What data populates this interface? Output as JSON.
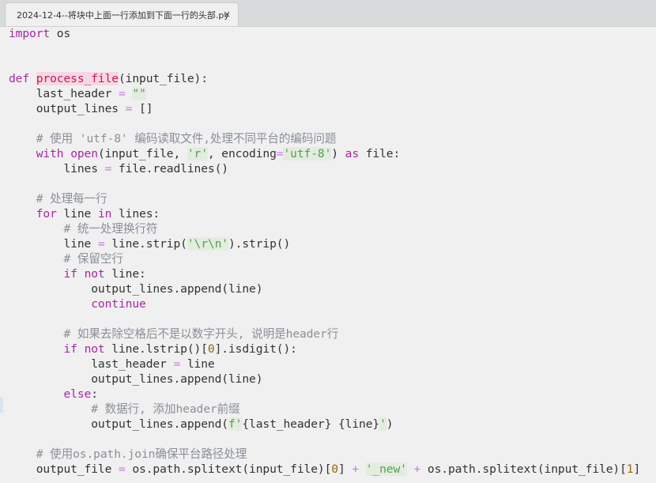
{
  "tab": {
    "title": "2024-12-4--将块中上面一行添加到下面一行的头部.py",
    "close": "×"
  },
  "code": [
    [
      {
        "t": "import",
        "c": "kw"
      },
      {
        "t": " os"
      }
    ],
    [],
    [],
    [
      {
        "t": "def",
        "c": "kw"
      },
      {
        "t": " "
      },
      {
        "t": "process_file",
        "c": "fn"
      },
      {
        "t": "(input_file):"
      }
    ],
    [
      {
        "t": "    last_header "
      },
      {
        "t": "=",
        "c": "op"
      },
      {
        "t": " "
      },
      {
        "t": "\"\"",
        "c": "str"
      }
    ],
    [
      {
        "t": "    output_lines "
      },
      {
        "t": "=",
        "c": "op"
      },
      {
        "t": " []"
      }
    ],
    [],
    [
      {
        "t": "    # 使用 'utf-8' 编码读取文件,处理不同平台的编码问题",
        "c": "cm"
      }
    ],
    [
      {
        "t": "    "
      },
      {
        "t": "with",
        "c": "kw"
      },
      {
        "t": " "
      },
      {
        "t": "open",
        "c": "bi"
      },
      {
        "t": "(input_file, "
      },
      {
        "t": "'r'",
        "c": "str"
      },
      {
        "t": ", encoding"
      },
      {
        "t": "=",
        "c": "op"
      },
      {
        "t": "'utf-8'",
        "c": "str"
      },
      {
        "t": ") "
      },
      {
        "t": "as",
        "c": "kw"
      },
      {
        "t": " file:"
      }
    ],
    [
      {
        "t": "        lines "
      },
      {
        "t": "=",
        "c": "op"
      },
      {
        "t": " file.readlines()"
      }
    ],
    [],
    [
      {
        "t": "    # 处理每一行",
        "c": "cm"
      }
    ],
    [
      {
        "t": "    "
      },
      {
        "t": "for",
        "c": "kw"
      },
      {
        "t": " line "
      },
      {
        "t": "in",
        "c": "kw"
      },
      {
        "t": " lines:"
      }
    ],
    [
      {
        "t": "        # 统一处理换行符",
        "c": "cm"
      }
    ],
    [
      {
        "t": "        line "
      },
      {
        "t": "=",
        "c": "op"
      },
      {
        "t": " line.strip("
      },
      {
        "t": "'\\r\\n'",
        "c": "str"
      },
      {
        "t": ").strip()"
      }
    ],
    [
      {
        "t": "        # 保留空行",
        "c": "cm"
      }
    ],
    [
      {
        "t": "        "
      },
      {
        "t": "if",
        "c": "kw"
      },
      {
        "t": " "
      },
      {
        "t": "not",
        "c": "kw"
      },
      {
        "t": " line:"
      }
    ],
    [
      {
        "t": "            output_lines.append(line)"
      }
    ],
    [
      {
        "t": "            "
      },
      {
        "t": "continue",
        "c": "kw"
      }
    ],
    [],
    [
      {
        "t": "        # 如果去除空格后不是以数字开头, 说明是header行",
        "c": "cm"
      }
    ],
    [
      {
        "t": "        "
      },
      {
        "t": "if",
        "c": "kw"
      },
      {
        "t": " "
      },
      {
        "t": "not",
        "c": "kw"
      },
      {
        "t": " line.lstrip()["
      },
      {
        "t": "0",
        "c": "num"
      },
      {
        "t": "].isdigit():"
      }
    ],
    [
      {
        "t": "            last_header "
      },
      {
        "t": "=",
        "c": "op"
      },
      {
        "t": " line"
      }
    ],
    [
      {
        "t": "            output_lines.append(line)"
      }
    ],
    [
      {
        "t": "        "
      },
      {
        "t": "else",
        "c": "kw"
      },
      {
        "t": ":"
      }
    ],
    [
      {
        "t": "            # 数据行, 添加header前缀",
        "c": "cm"
      }
    ],
    [
      {
        "t": "            output_lines.append("
      },
      {
        "t": "f'",
        "c": "str"
      },
      {
        "t": "{last_header} {line}"
      },
      {
        "t": "'",
        "c": "str"
      },
      {
        "t": ")"
      }
    ],
    [],
    [
      {
        "t": "    # 使用os.path.join确保平台路径处理",
        "c": "cm"
      }
    ],
    [
      {
        "t": "    output_file "
      },
      {
        "t": "=",
        "c": "op"
      },
      {
        "t": " os.path.splitext(input_file)["
      },
      {
        "t": "0",
        "c": "num"
      },
      {
        "t": "] "
      },
      {
        "t": "+",
        "c": "op"
      },
      {
        "t": " "
      },
      {
        "t": "'_new'",
        "c": "str"
      },
      {
        "t": " "
      },
      {
        "t": "+",
        "c": "op"
      },
      {
        "t": " os.path.splitext(input_file)["
      },
      {
        "t": "1",
        "c": "num"
      },
      {
        "t": "]"
      }
    ]
  ]
}
